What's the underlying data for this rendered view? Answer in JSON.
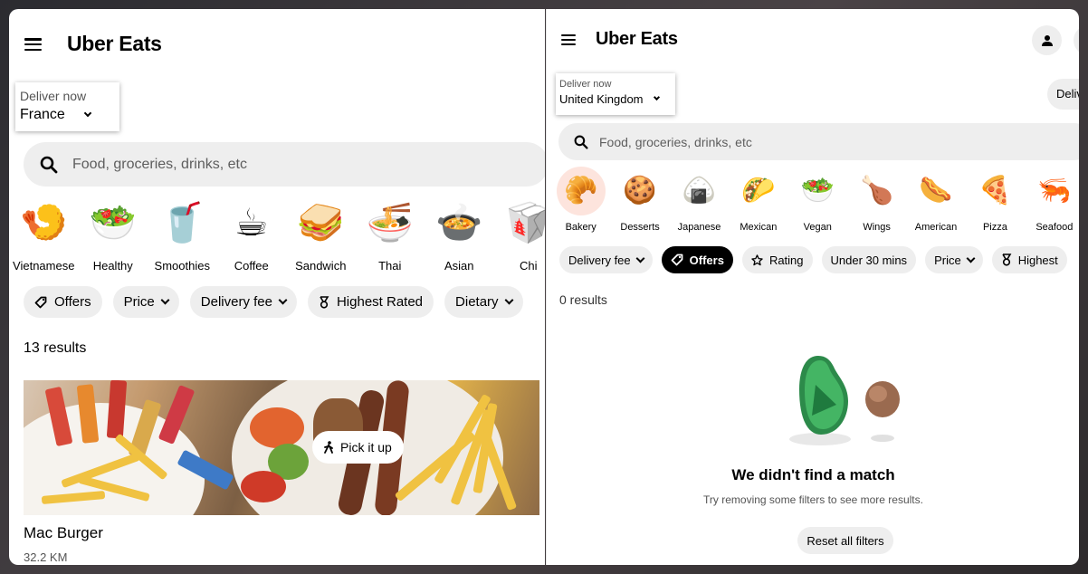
{
  "left": {
    "logo": "Uber Eats",
    "deliver": {
      "label": "Deliver now",
      "value": "France"
    },
    "search": {
      "placeholder": "Food, groceries, drinks, etc"
    },
    "categories": [
      {
        "label": "Vietnamese",
        "icon": "🍤"
      },
      {
        "label": "Healthy",
        "icon": "🥗"
      },
      {
        "label": "Smoothies",
        "icon": "🥤"
      },
      {
        "label": "Coffee",
        "icon": "☕"
      },
      {
        "label": "Sandwich",
        "icon": "🥪"
      },
      {
        "label": "Thai",
        "icon": "🍜"
      },
      {
        "label": "Asian",
        "icon": "🍲"
      },
      {
        "label": "Chi",
        "icon": "🥡"
      }
    ],
    "chips": [
      {
        "label": "Offers",
        "icon": "tag-icon"
      },
      {
        "label": "Price",
        "icon": "chevron-down-icon"
      },
      {
        "label": "Delivery fee",
        "icon": "chevron-down-icon"
      },
      {
        "label": "Highest Rated",
        "icon": "ribbon-icon"
      },
      {
        "label": "Dietary",
        "icon": "chevron-down-icon"
      }
    ],
    "results": "13 results",
    "store": {
      "pickup_label": "Pick it up",
      "name": "Mac Burger",
      "distance": "32.2 KM"
    }
  },
  "right": {
    "logo": "Uber Eats",
    "deliver": {
      "label": "Deliver now",
      "value": "United Kingdom"
    },
    "deliver_toggle": "Deliv",
    "search": {
      "placeholder": "Food, groceries, drinks, etc"
    },
    "categories": [
      {
        "label": "Bakery",
        "icon": "🥐"
      },
      {
        "label": "Desserts",
        "icon": "🍪"
      },
      {
        "label": "Japanese",
        "icon": "🍙"
      },
      {
        "label": "Mexican",
        "icon": "🌮"
      },
      {
        "label": "Vegan",
        "icon": "🥗"
      },
      {
        "label": "Wings",
        "icon": "🍗"
      },
      {
        "label": "American",
        "icon": "🌭"
      },
      {
        "label": "Pizza",
        "icon": "🍕"
      },
      {
        "label": "Seafood",
        "icon": "🦐"
      }
    ],
    "chips": [
      {
        "label": "Delivery fee",
        "icon": "chevron-down-icon"
      },
      {
        "label": "Offers",
        "icon": "tag-icon",
        "active": true
      },
      {
        "label": "Rating",
        "icon": "star-icon"
      },
      {
        "label": "Under 30 mins",
        "icon": ""
      },
      {
        "label": "Price",
        "icon": "chevron-down-icon"
      },
      {
        "label": "Highest",
        "icon": "ribbon-icon"
      }
    ],
    "results": "0 results",
    "empty": {
      "title": "We didn't find a match",
      "subtitle": "Try removing some filters to see more results.",
      "reset_label": "Reset all filters"
    }
  },
  "colors": {
    "chip_bg": "#eeeeee",
    "active_chip_bg": "#000000",
    "selected_category_bg": "#fde4dd",
    "avocado_green": "#3fae5c"
  }
}
